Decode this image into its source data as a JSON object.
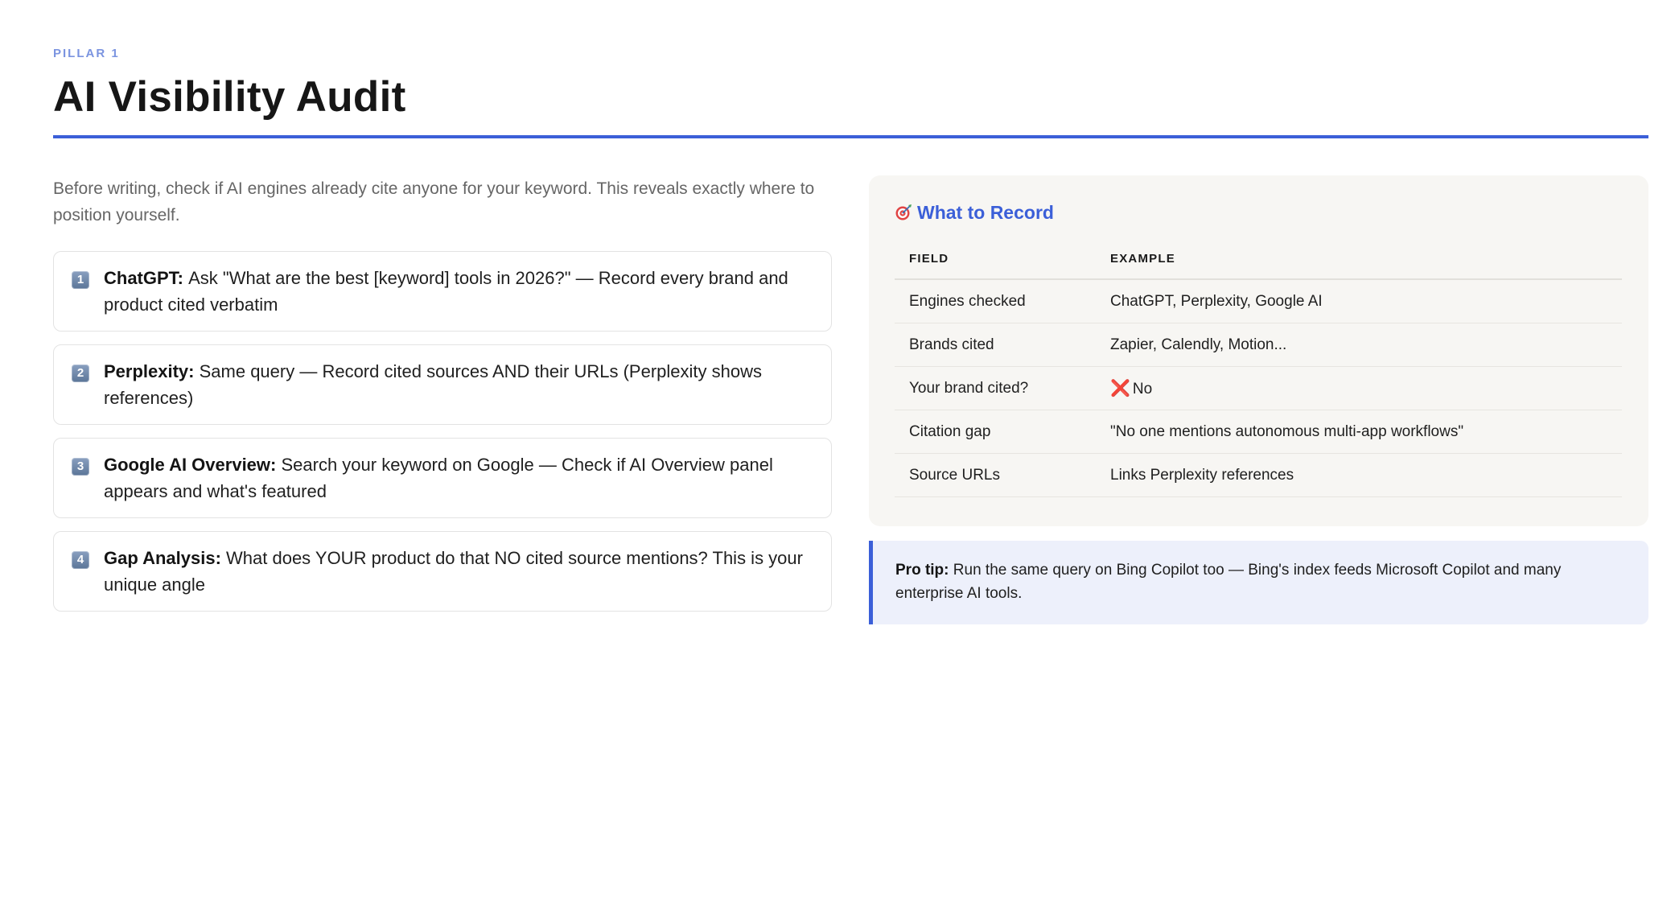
{
  "header": {
    "eyebrow": "PILLAR 1",
    "title": "AI Visibility Audit"
  },
  "intro": "Before writing, check if AI engines already cite anyone for your keyword. This reveals exactly where to position yourself.",
  "steps": [
    {
      "number": "1",
      "label": "ChatGPT:",
      "text": "Ask \"What are the best [keyword] tools in 2026?\" — Record every brand and product cited verbatim"
    },
    {
      "number": "2",
      "label": "Perplexity:",
      "text": "Same query — Record cited sources AND their URLs (Perplexity shows references)"
    },
    {
      "number": "3",
      "label": "Google AI Overview:",
      "text": "Search your keyword on Google — Check if AI Overview panel appears and what's featured"
    },
    {
      "number": "4",
      "label": "Gap Analysis:",
      "text": "What does YOUR product do that NO cited source mentions? This is your unique angle"
    }
  ],
  "record": {
    "icon": "target-icon",
    "title": "What to Record",
    "columns": [
      "FIELD",
      "EXAMPLE"
    ],
    "rows": [
      {
        "field": "Engines checked",
        "example": "ChatGPT, Perplexity, Google AI"
      },
      {
        "field": "Brands cited",
        "example": "Zapier, Calendly, Motion..."
      },
      {
        "field": "Your brand cited?",
        "mark": "❌",
        "example": "No"
      },
      {
        "field": "Citation gap",
        "example": "\"No one mentions autonomous multi-app workflows\""
      },
      {
        "field": "Source URLs",
        "example": "Links Perplexity references"
      }
    ]
  },
  "pro_tip": {
    "label": "Pro tip:",
    "text": " Run the same query on Bing Copilot too — Bing's index feeds Microsoft Copilot and many enterprise AI tools."
  },
  "colors": {
    "accent": "#3b5fd8",
    "eyebrow": "#7b94e0",
    "card_bg": "#f7f6f3",
    "tip_bg": "#edf0fb"
  }
}
